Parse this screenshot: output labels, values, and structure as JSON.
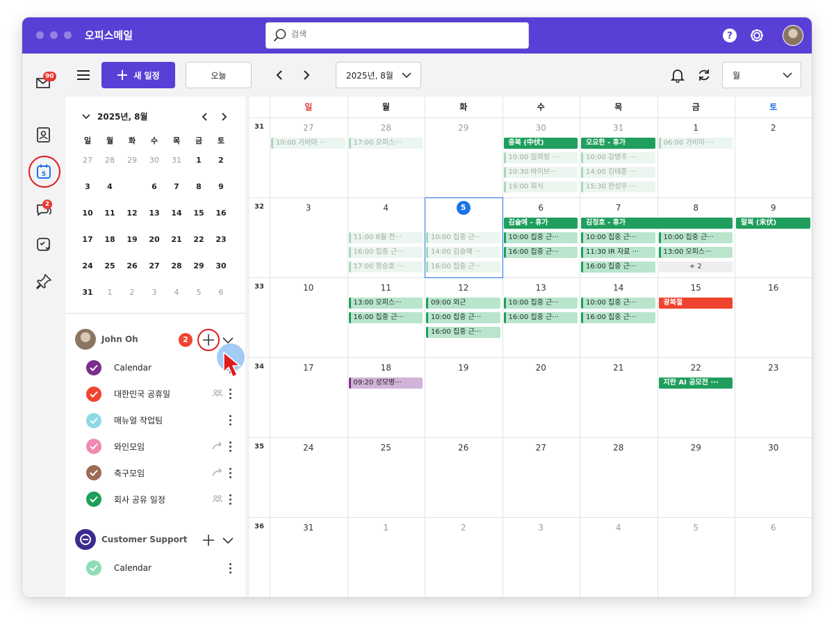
{
  "app": {
    "title": "오피스메일"
  },
  "search": {
    "placeholder": "검색"
  },
  "rail": {
    "mail_badge": "90",
    "chat_badge": "2"
  },
  "toolbar": {
    "new_event": "새 일정",
    "today": "오늘",
    "current_month": "2025년, 8월",
    "view": "월"
  },
  "mini_calendar": {
    "title": "2025년, 8월",
    "weekdays": [
      "일",
      "월",
      "화",
      "수",
      "목",
      "금",
      "토"
    ],
    "weeks": [
      [
        {
          "d": "27",
          "m": true
        },
        {
          "d": "28",
          "m": true
        },
        {
          "d": "29",
          "m": true
        },
        {
          "d": "30",
          "m": true
        },
        {
          "d": "31",
          "m": true
        },
        {
          "d": "1"
        },
        {
          "d": "2"
        }
      ],
      [
        {
          "d": "3"
        },
        {
          "d": "4"
        },
        {
          "d": "5",
          "t": true
        },
        {
          "d": "6"
        },
        {
          "d": "7"
        },
        {
          "d": "8"
        },
        {
          "d": "9"
        }
      ],
      [
        {
          "d": "10"
        },
        {
          "d": "11"
        },
        {
          "d": "12"
        },
        {
          "d": "13"
        },
        {
          "d": "14"
        },
        {
          "d": "15"
        },
        {
          "d": "16"
        }
      ],
      [
        {
          "d": "17"
        },
        {
          "d": "18"
        },
        {
          "d": "19"
        },
        {
          "d": "20"
        },
        {
          "d": "21"
        },
        {
          "d": "22"
        },
        {
          "d": "23"
        }
      ],
      [
        {
          "d": "24"
        },
        {
          "d": "25"
        },
        {
          "d": "26"
        },
        {
          "d": "27"
        },
        {
          "d": "28"
        },
        {
          "d": "29"
        },
        {
          "d": "30"
        }
      ],
      [
        {
          "d": "31"
        },
        {
          "d": "1",
          "m": true
        },
        {
          "d": "2",
          "m": true
        },
        {
          "d": "3",
          "m": true
        },
        {
          "d": "4",
          "m": true
        },
        {
          "d": "5",
          "m": true
        },
        {
          "d": "6",
          "m": true
        }
      ]
    ]
  },
  "accounts": [
    {
      "name": "John Oh",
      "badge": "2",
      "calendars": [
        {
          "name": "Calendar",
          "color": "#7b2d8b",
          "icon": ""
        },
        {
          "name": "대한민국 공휴일",
          "color": "#ef4430",
          "icon": "group"
        },
        {
          "name": "매뉴얼 작업팀",
          "color": "#8fd9e4",
          "icon": ""
        },
        {
          "name": "와인모임",
          "color": "#f08ab3",
          "icon": "share"
        },
        {
          "name": "축구모임",
          "color": "#9c6b58",
          "icon": "share"
        },
        {
          "name": "회사 공유 일정",
          "color": "#1f9e5e",
          "icon": "group"
        }
      ]
    },
    {
      "name": "Customer Support",
      "badge": "",
      "calendars": [
        {
          "name": "Calendar",
          "color": "#8fdcb8",
          "icon": ""
        }
      ]
    }
  ],
  "month_view": {
    "weekdays": [
      {
        "label": "일",
        "color": "#e53935"
      },
      {
        "label": "월",
        "color": "#222222"
      },
      {
        "label": "화",
        "color": "#222222"
      },
      {
        "label": "수",
        "color": "#222222"
      },
      {
        "label": "목",
        "color": "#222222"
      },
      {
        "label": "금",
        "color": "#222222"
      },
      {
        "label": "토",
        "color": "#1a73e8"
      }
    ],
    "weeks": [
      {
        "num": "31",
        "days": [
          {
            "d": "27",
            "m": true
          },
          {
            "d": "28",
            "m": true
          },
          {
            "d": "29",
            "m": true
          },
          {
            "d": "30",
            "m": true
          },
          {
            "d": "31",
            "m": true
          },
          {
            "d": "1"
          },
          {
            "d": "2"
          }
        ]
      },
      {
        "num": "32",
        "days": [
          {
            "d": "3"
          },
          {
            "d": "4"
          },
          {
            "d": "5",
            "t": true
          },
          {
            "d": "6"
          },
          {
            "d": "7"
          },
          {
            "d": "8"
          },
          {
            "d": "9"
          }
        ]
      },
      {
        "num": "33",
        "days": [
          {
            "d": "10"
          },
          {
            "d": "11"
          },
          {
            "d": "12"
          },
          {
            "d": "13"
          },
          {
            "d": "14"
          },
          {
            "d": "15"
          },
          {
            "d": "16"
          }
        ]
      },
      {
        "num": "34",
        "days": [
          {
            "d": "17"
          },
          {
            "d": "18"
          },
          {
            "d": "19"
          },
          {
            "d": "20"
          },
          {
            "d": "21"
          },
          {
            "d": "22"
          },
          {
            "d": "23"
          }
        ]
      },
      {
        "num": "35",
        "days": [
          {
            "d": "24"
          },
          {
            "d": "25"
          },
          {
            "d": "26"
          },
          {
            "d": "27"
          },
          {
            "d": "28"
          },
          {
            "d": "29"
          },
          {
            "d": "30"
          }
        ]
      },
      {
        "num": "36",
        "days": [
          {
            "d": "31"
          },
          {
            "d": "1",
            "m": true
          },
          {
            "d": "2",
            "m": true
          },
          {
            "d": "3",
            "m": true
          },
          {
            "d": "4",
            "m": true
          },
          {
            "d": "5",
            "m": true
          },
          {
            "d": "6",
            "m": true
          }
        ]
      }
    ],
    "events": [
      {
        "week": 0,
        "day": 0,
        "span": 1,
        "slot": 0,
        "text": "10:00 가비아 ···",
        "style": "faded"
      },
      {
        "week": 0,
        "day": 1,
        "span": 1,
        "slot": 0,
        "text": "17:00 오피스···",
        "style": "faded"
      },
      {
        "week": 0,
        "day": 3,
        "span": 1,
        "slot": 0,
        "text": "중복 (中伏)",
        "style": "green"
      },
      {
        "week": 0,
        "day": 3,
        "span": 1,
        "slot": 1,
        "text": "10:00 임희정 ···",
        "style": "faded"
      },
      {
        "week": 0,
        "day": 3,
        "span": 1,
        "slot": 2,
        "text": "10:30 바이브···",
        "style": "faded"
      },
      {
        "week": 0,
        "day": 3,
        "span": 1,
        "slot": 3,
        "text": "19:00 회식",
        "style": "faded"
      },
      {
        "week": 0,
        "day": 4,
        "span": 1,
        "slot": 0,
        "text": "오요한 - 휴가",
        "style": "green"
      },
      {
        "week": 0,
        "day": 4,
        "span": 1,
        "slot": 1,
        "text": "10:00 강병주 ···",
        "style": "faded"
      },
      {
        "week": 0,
        "day": 4,
        "span": 1,
        "slot": 2,
        "text": "14:00 김태훈 ···",
        "style": "faded"
      },
      {
        "week": 0,
        "day": 4,
        "span": 1,
        "slot": 3,
        "text": "15:30 한성우 ···",
        "style": "faded"
      },
      {
        "week": 0,
        "day": 5,
        "span": 1,
        "slot": 0,
        "text": "06:00 가비아 ···",
        "style": "faded"
      },
      {
        "week": 1,
        "day": 1,
        "span": 1,
        "slot": 1,
        "text": "11:00 8월 전···",
        "style": "faded"
      },
      {
        "week": 1,
        "day": 1,
        "span": 1,
        "slot": 2,
        "text": "16:00 집중 근···",
        "style": "faded"
      },
      {
        "week": 1,
        "day": 1,
        "span": 1,
        "slot": 3,
        "text": "17:00 정승호 ···",
        "style": "faded"
      },
      {
        "week": 1,
        "day": 2,
        "span": 1,
        "slot": 1,
        "text": "10:00 집중 근···",
        "style": "faded"
      },
      {
        "week": 1,
        "day": 2,
        "span": 1,
        "slot": 2,
        "text": "14:00 김슬예 ···",
        "style": "faded"
      },
      {
        "week": 1,
        "day": 2,
        "span": 1,
        "slot": 3,
        "text": "16:00 집중 근···",
        "style": "faded"
      },
      {
        "week": 1,
        "day": 3,
        "span": 1,
        "slot": 0,
        "text": "김슬예 - 휴가",
        "style": "green"
      },
      {
        "week": 1,
        "day": 3,
        "span": 1,
        "slot": 1,
        "text": "10:00 집중 근···",
        "style": "mint"
      },
      {
        "week": 1,
        "day": 3,
        "span": 1,
        "slot": 2,
        "text": "16:00 집중 근···",
        "style": "mint"
      },
      {
        "week": 1,
        "day": 4,
        "span": 2,
        "slot": 0,
        "text": "김정호 - 휴가",
        "style": "green"
      },
      {
        "week": 1,
        "day": 4,
        "span": 1,
        "slot": 1,
        "text": "10:00 집중 근···",
        "style": "mint"
      },
      {
        "week": 1,
        "day": 4,
        "span": 1,
        "slot": 2,
        "text": "11:30 IR 자료 ···",
        "style": "mint"
      },
      {
        "week": 1,
        "day": 4,
        "span": 1,
        "slot": 3,
        "text": "16:00 집중 근···",
        "style": "mint"
      },
      {
        "week": 1,
        "day": 5,
        "span": 1,
        "slot": 1,
        "text": "10:00 집중 근···",
        "style": "mint"
      },
      {
        "week": 1,
        "day": 5,
        "span": 1,
        "slot": 2,
        "text": "13:00 오피스···",
        "style": "mint"
      },
      {
        "week": 1,
        "day": 5,
        "span": 1,
        "slot": 3,
        "text": "+ 2",
        "style": "more"
      },
      {
        "week": 1,
        "day": 6,
        "span": 1,
        "slot": 0,
        "text": "말복 (末伏)",
        "style": "green"
      },
      {
        "week": 2,
        "day": 1,
        "span": 1,
        "slot": 0,
        "text": "13:00 오피스···",
        "style": "mint"
      },
      {
        "week": 2,
        "day": 1,
        "span": 1,
        "slot": 1,
        "text": "16:00 집중 근···",
        "style": "mint"
      },
      {
        "week": 2,
        "day": 2,
        "span": 1,
        "slot": 0,
        "text": "09:00 외근",
        "style": "mint"
      },
      {
        "week": 2,
        "day": 2,
        "span": 1,
        "slot": 1,
        "text": "10:00 집중 근···",
        "style": "mint"
      },
      {
        "week": 2,
        "day": 2,
        "span": 1,
        "slot": 2,
        "text": "16:00 집중 근···",
        "style": "mint"
      },
      {
        "week": 2,
        "day": 3,
        "span": 1,
        "slot": 0,
        "text": "10:00 집중 근···",
        "style": "mint"
      },
      {
        "week": 2,
        "day": 3,
        "span": 1,
        "slot": 1,
        "text": "16:00 집중 근···",
        "style": "mint"
      },
      {
        "week": 2,
        "day": 4,
        "span": 1,
        "slot": 0,
        "text": "10:00 집중 근···",
        "style": "mint"
      },
      {
        "week": 2,
        "day": 4,
        "span": 1,
        "slot": 1,
        "text": "16:00 집중 근···",
        "style": "mint"
      },
      {
        "week": 2,
        "day": 5,
        "span": 1,
        "slot": 0,
        "text": "광복절",
        "style": "red"
      },
      {
        "week": 3,
        "day": 1,
        "span": 1,
        "slot": 0,
        "text": "09:20 성모병···",
        "style": "purple"
      },
      {
        "week": 3,
        "day": 5,
        "span": 1,
        "slot": 0,
        "text": "지란 AI 공모전 ···",
        "style": "green"
      }
    ]
  },
  "colors": {
    "brand": "#5a3fd6",
    "today": "#1a73e8",
    "highlight": "#e0191b"
  }
}
